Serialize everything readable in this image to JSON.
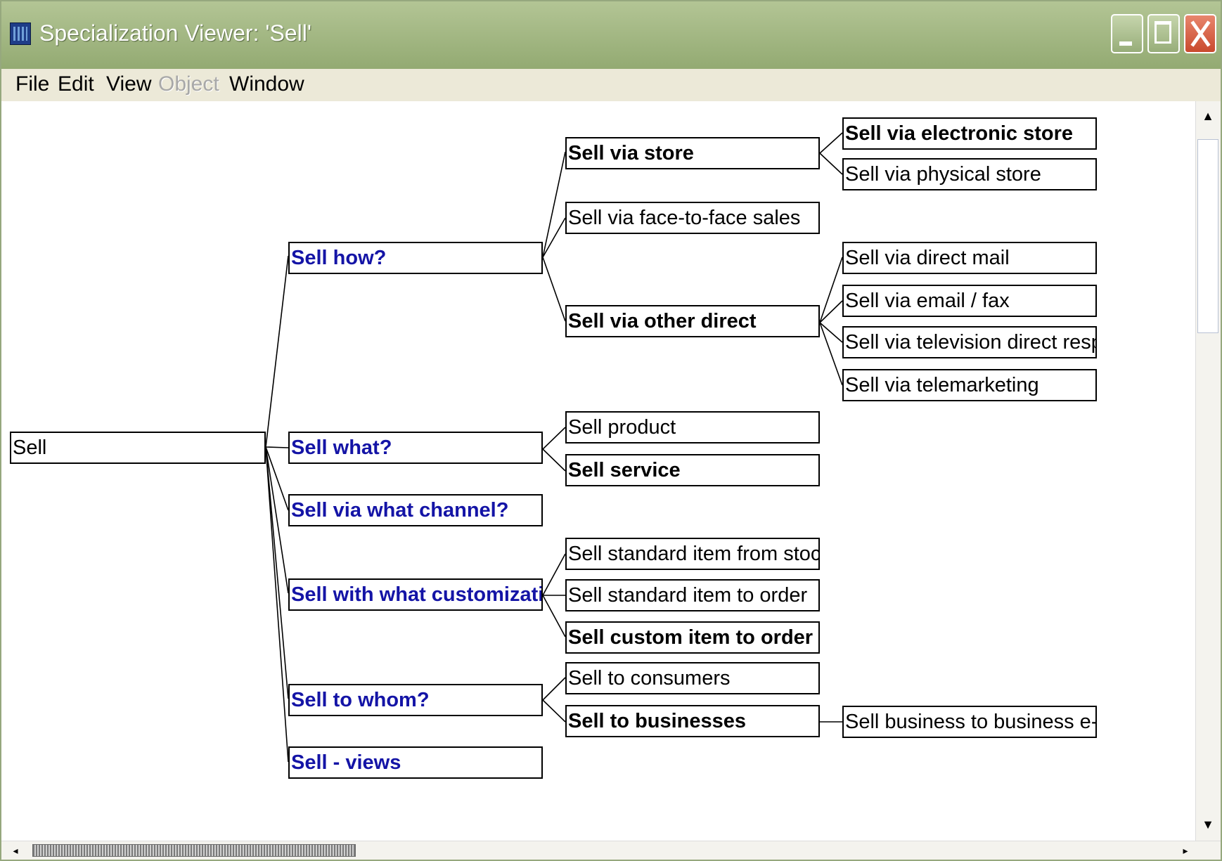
{
  "window": {
    "title": "Specialization Viewer: 'Sell'",
    "controls": {
      "minimize_icon": "minimize-icon",
      "maximize_icon": "maximize-icon",
      "close_icon": "close-icon"
    }
  },
  "menu": {
    "items": [
      {
        "label": "File",
        "enabled": true
      },
      {
        "label": "Edit",
        "enabled": true
      },
      {
        "label": "View",
        "enabled": true
      },
      {
        "label": "Object",
        "enabled": false
      },
      {
        "label": "Window",
        "enabled": true
      }
    ]
  },
  "tree": {
    "root": {
      "label": "Sell"
    },
    "questions": [
      {
        "label": "Sell how?"
      },
      {
        "label": "Sell what?"
      },
      {
        "label": "Sell via what channel?"
      },
      {
        "label": "Sell with what customization?"
      },
      {
        "label": "Sell to whom?"
      },
      {
        "label": "Sell - views"
      }
    ],
    "level2": [
      {
        "label": "Sell via store",
        "bold": true
      },
      {
        "label": "Sell via face-to-face sales",
        "bold": false
      },
      {
        "label": "Sell via other direct",
        "bold": true
      },
      {
        "label": "Sell product",
        "bold": false
      },
      {
        "label": "Sell service",
        "bold": true
      },
      {
        "label": "Sell standard item from stock",
        "bold": false
      },
      {
        "label": "Sell standard item to order",
        "bold": false
      },
      {
        "label": "Sell custom item to order",
        "bold": true
      },
      {
        "label": "Sell to consumers",
        "bold": false
      },
      {
        "label": "Sell to businesses",
        "bold": true
      }
    ],
    "level3": [
      {
        "label": "Sell via electronic store",
        "bold": true
      },
      {
        "label": "Sell via physical store",
        "bold": false
      },
      {
        "label": "Sell via direct mail",
        "bold": false
      },
      {
        "label": "Sell via email / fax",
        "bold": false
      },
      {
        "label": "Sell via television direct respons...",
        "bold": false
      },
      {
        "label": "Sell via telemarketing",
        "bold": false
      },
      {
        "label": "Sell business to business e-com...",
        "bold": false
      }
    ]
  },
  "colors": {
    "titlebar": "#9db27e",
    "menubar": "#ece9d8",
    "question_text": "#1414a6",
    "node_border": "#000000"
  },
  "scrollbars": {
    "vertical": {
      "up_icon": "scroll-up-icon",
      "down_icon": "scroll-down-icon"
    },
    "horizontal": {
      "left_icon": "scroll-left-icon",
      "right_icon": "scroll-right-icon"
    }
  }
}
